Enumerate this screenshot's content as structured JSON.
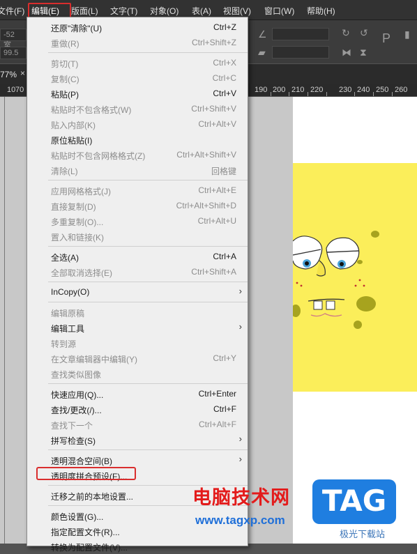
{
  "menubar": {
    "items": [
      "文件(F)",
      "编辑(E)",
      "版面(L)",
      "文字(T)",
      "对象(O)",
      "表(A)",
      "视图(V)",
      "窗口(W)",
      "帮助(H)"
    ]
  },
  "toolbar": {
    "field1": "-52 室",
    "field2": "99.5"
  },
  "tab": {
    "zoom": "77%",
    "close": "×"
  },
  "ruler": {
    "left": [
      "10",
      "70"
    ],
    "right": [
      "190",
      "200",
      "210",
      "220",
      "230",
      "240",
      "250",
      "260"
    ]
  },
  "menu": {
    "g1": [
      {
        "label": "还原\"清除\"(U)",
        "shortcut": "Ctrl+Z",
        "disabled": false
      },
      {
        "label": "重做(R)",
        "shortcut": "Ctrl+Shift+Z",
        "disabled": true
      }
    ],
    "g2": [
      {
        "label": "剪切(T)",
        "shortcut": "Ctrl+X",
        "disabled": true
      },
      {
        "label": "复制(C)",
        "shortcut": "Ctrl+C",
        "disabled": true
      },
      {
        "label": "粘贴(P)",
        "shortcut": "Ctrl+V",
        "disabled": false
      },
      {
        "label": "粘贴时不包含格式(W)",
        "shortcut": "Ctrl+Shift+V",
        "disabled": true
      },
      {
        "label": "贴入内部(K)",
        "shortcut": "Ctrl+Alt+V",
        "disabled": true
      },
      {
        "label": "原位粘贴(I)",
        "shortcut": "",
        "disabled": false
      },
      {
        "label": "粘贴时不包含网格格式(Z)",
        "shortcut": "Ctrl+Alt+Shift+V",
        "disabled": true
      },
      {
        "label": "清除(L)",
        "shortcut": "回格键",
        "disabled": true
      }
    ],
    "g3": [
      {
        "label": "应用网格格式(J)",
        "shortcut": "Ctrl+Alt+E",
        "disabled": true
      },
      {
        "label": "直接复制(D)",
        "shortcut": "Ctrl+Alt+Shift+D",
        "disabled": true
      },
      {
        "label": "多重复制(O)...",
        "shortcut": "Ctrl+Alt+U",
        "disabled": true
      },
      {
        "label": "置入和链接(K)",
        "shortcut": "",
        "disabled": true
      }
    ],
    "g4": [
      {
        "label": "全选(A)",
        "shortcut": "Ctrl+A",
        "disabled": false
      },
      {
        "label": "全部取消选择(E)",
        "shortcut": "Ctrl+Shift+A",
        "disabled": true
      }
    ],
    "g5": [
      {
        "label": "InCopy(O)",
        "shortcut": "",
        "disabled": false,
        "submenu": true
      }
    ],
    "g6": [
      {
        "label": "编辑原稿",
        "shortcut": "",
        "disabled": true
      },
      {
        "label": "编辑工具",
        "shortcut": "",
        "disabled": false,
        "submenu": true
      },
      {
        "label": "转到源",
        "shortcut": "",
        "disabled": true
      },
      {
        "label": "在文章编辑器中编辑(Y)",
        "shortcut": "Ctrl+Y",
        "disabled": true
      },
      {
        "label": "查找类似图像",
        "shortcut": "",
        "disabled": true
      }
    ],
    "g7": [
      {
        "label": "快速应用(Q)...",
        "shortcut": "Ctrl+Enter",
        "disabled": false
      },
      {
        "label": "查找/更改(/)...",
        "shortcut": "Ctrl+F",
        "disabled": false
      },
      {
        "label": "查找下一个",
        "shortcut": "Ctrl+Alt+F",
        "disabled": true
      },
      {
        "label": "拼写检查(S)",
        "shortcut": "",
        "disabled": false,
        "submenu": true
      }
    ],
    "g8": [
      {
        "label": "透明混合空间(B)",
        "shortcut": "",
        "disabled": false,
        "submenu": true
      },
      {
        "label": "透明度拼合预设(F)...",
        "shortcut": "",
        "disabled": false
      }
    ],
    "g9": [
      {
        "label": "迁移之前的本地设置...",
        "shortcut": "",
        "disabled": false
      }
    ],
    "g10": [
      {
        "label": "颜色设置(G)...",
        "shortcut": "",
        "disabled": false
      },
      {
        "label": "指定配置文件(R)...",
        "shortcut": "",
        "disabled": false
      },
      {
        "label": "转换为配置文件(V)...",
        "shortcut": "",
        "disabled": false
      }
    ]
  },
  "watermark": {
    "text": "电脑技术网",
    "url": "www.tagxp.com",
    "logo": "TAG",
    "site": "极光下载站"
  },
  "colors": {
    "highlight": "#d92d2d",
    "yellow": "#fbee5a"
  }
}
